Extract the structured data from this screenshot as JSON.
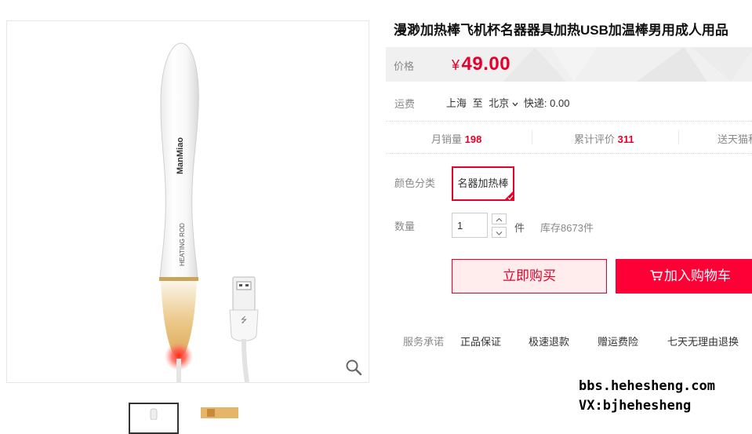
{
  "product": {
    "title": "漫渺加热棒飞机杯名器器具加热USB加温棒男用成人用品",
    "image_brand_text": "ManMiao",
    "image_label_text": "HEATING ROD"
  },
  "price": {
    "label": "价格",
    "currency": "¥",
    "value": "49.00"
  },
  "shipping": {
    "label": "运费",
    "from": "上海",
    "to_word": "至",
    "destination": "北京",
    "express": "快递: 0.00"
  },
  "stats": {
    "monthly_sales_label": "月销量",
    "monthly_sales_value": "198",
    "reviews_label": "累计评价",
    "reviews_value": "311",
    "points_label": "送天猫积"
  },
  "sku": {
    "label": "颜色分类",
    "selected_option": "名器加热棒"
  },
  "quantity": {
    "label": "数量",
    "value": "1",
    "unit": "件",
    "stock": "库存8673件"
  },
  "actions": {
    "buy_now": "立即购买",
    "add_to_cart": "加入购物车"
  },
  "services": {
    "label": "服务承诺",
    "items": [
      "正品保证",
      "极速退款",
      "赠运费险",
      "七天无理由退换"
    ]
  },
  "watermark": {
    "line1": "bbs.hehesheng.com",
    "line2": "VX:bjhehesheng"
  },
  "colors": {
    "accent": "#e4002b",
    "cart_button": "#ff0036",
    "buy_button_bg": "#ffeded",
    "price_bar_bg": "#f0f0f0"
  },
  "icons": {
    "zoom": "magnifier-icon",
    "cart": "cart-icon",
    "chevron": "chevron-down-icon",
    "check": "corner-check-icon"
  }
}
